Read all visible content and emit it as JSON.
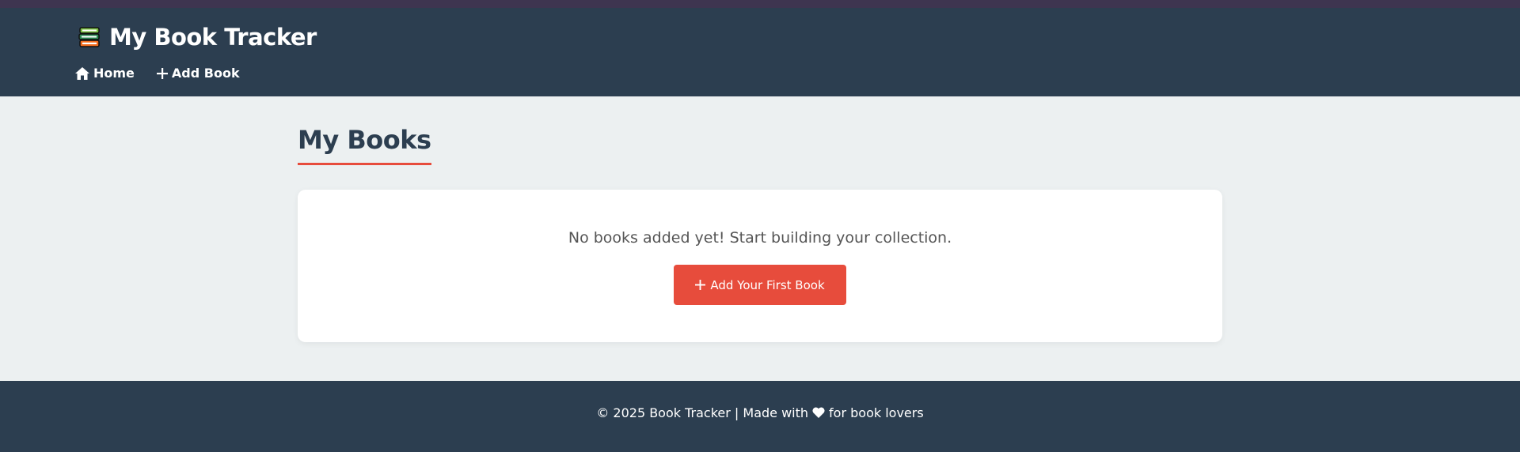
{
  "header": {
    "brand_icon": "books-icon",
    "title": "My Book Tracker",
    "nav": [
      {
        "label": "Home",
        "icon": "home-icon"
      },
      {
        "label": "Add Book",
        "icon": "plus-icon"
      }
    ]
  },
  "main": {
    "title": "My Books",
    "empty_message": "No books added yet! Start building your collection.",
    "add_first_button": {
      "label": "Add Your First Book",
      "icon": "plus-icon"
    }
  },
  "footer": {
    "text_before": "© 2025 Book Tracker | Made with",
    "icon": "heart-icon",
    "text_after": "for book lovers"
  },
  "colors": {
    "header_bg": "#2c3e50",
    "page_bg": "#ecf0f1",
    "accent": "#e74c3c",
    "title_text": "#2c3e50"
  }
}
